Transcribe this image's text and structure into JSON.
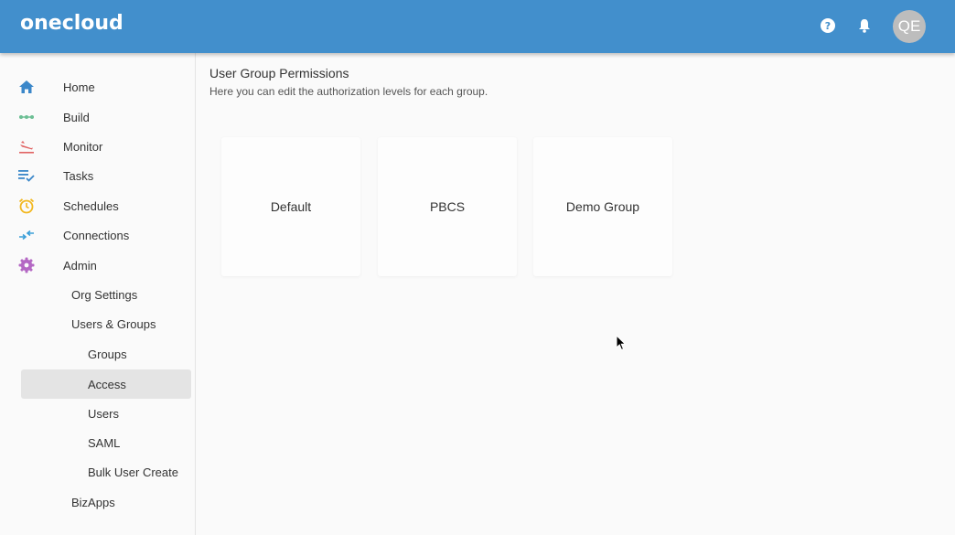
{
  "app": {
    "logo": "onecloud"
  },
  "header": {
    "avatar_initials": "QE",
    "icons": [
      "help-icon",
      "bell-icon"
    ]
  },
  "sidebar": {
    "items": [
      {
        "label": "Home",
        "icon": "home-icon",
        "color": "#3b87c9"
      },
      {
        "label": "Build",
        "icon": "build-icon",
        "color": "#6cbf94"
      },
      {
        "label": "Monitor",
        "icon": "monitor-icon",
        "color": "#e06262"
      },
      {
        "label": "Tasks",
        "icon": "tasks-icon",
        "color": "#3b87c9"
      },
      {
        "label": "Schedules",
        "icon": "alarm-clock-icon",
        "color": "#f2b71e"
      },
      {
        "label": "Connections",
        "icon": "connections-icon",
        "color": "#3b9fd8"
      },
      {
        "label": "Admin",
        "icon": "gear-icon",
        "color": "#b468c4"
      },
      {
        "label": "Org Settings"
      },
      {
        "label": "Users & Groups"
      },
      {
        "label": "Groups"
      },
      {
        "label": "Access",
        "active": true
      },
      {
        "label": "Users"
      },
      {
        "label": "SAML"
      },
      {
        "label": "Bulk User Create"
      },
      {
        "label": "BizApps"
      }
    ]
  },
  "main": {
    "title": "User Group Permissions",
    "subtitle": "Here you can edit the authorization levels for each group.",
    "groups": [
      "Default",
      "PBCS",
      "Demo Group"
    ]
  }
}
